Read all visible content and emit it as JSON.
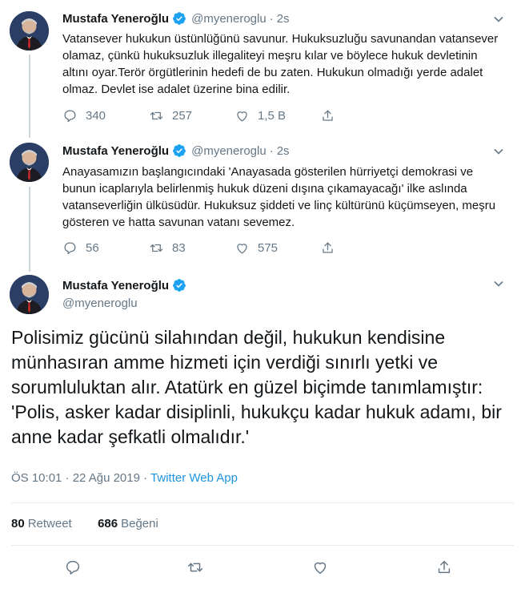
{
  "colors": {
    "accent": "#1b95e0",
    "muted": "#657786",
    "text": "#14171a"
  },
  "author": {
    "name": "Mustafa Yeneroğlu",
    "handle": "@myeneroglu"
  },
  "tweets": [
    {
      "time": "2s",
      "text": "Vatansever hukukun üstünlüğünü savunur. Hukuksuzluğu savunandan vatansever olamaz, çünkü hukuksuzluk illegaliteyi meşru kılar ve böylece hukuk devletinin altını oyar.Terör örgütlerinin hedefi de bu zaten. Hukukun olmadığı yerde adalet olmaz. Devlet ise adalet üzerine bina edilir.",
      "replies": "340",
      "retweets": "257",
      "likes": "1,5 B"
    },
    {
      "time": "2s",
      "text": "Anayasamızın başlangıcındaki 'Anayasada gösterilen hürriyetçi demokrasi ve bunun icaplarıyla belirlenmiş hukuk düzeni dışına çıkamayacağı' ilke aslında vatanseverliğin ülküsüdür. Hukuksuz şiddeti ve linç kültürünü küçümseyen, meşru gösteren ve hatta savunan vatanı sevemez.",
      "replies": "56",
      "retweets": "83",
      "likes": "575"
    }
  ],
  "main_tweet": {
    "text": "Polisimiz gücünü silahından değil, hukukun kendisine münhasıran amme hizmeti için verdiği sınırlı yetki ve sorumluluktan alır. Atatürk en güzel biçimde tanımlamıştır: 'Polis, asker kadar disiplinli, hukukçu kadar hukuk adamı, bir anne kadar şefkatli olmalıdır.'",
    "timestamp": "ÖS 10:01 · 22 Ağu 2019",
    "separator": "·",
    "app": "Twitter Web App",
    "retweet_count": "80",
    "retweet_label": "Retweet",
    "like_count": "686",
    "like_label": "Beğeni"
  }
}
